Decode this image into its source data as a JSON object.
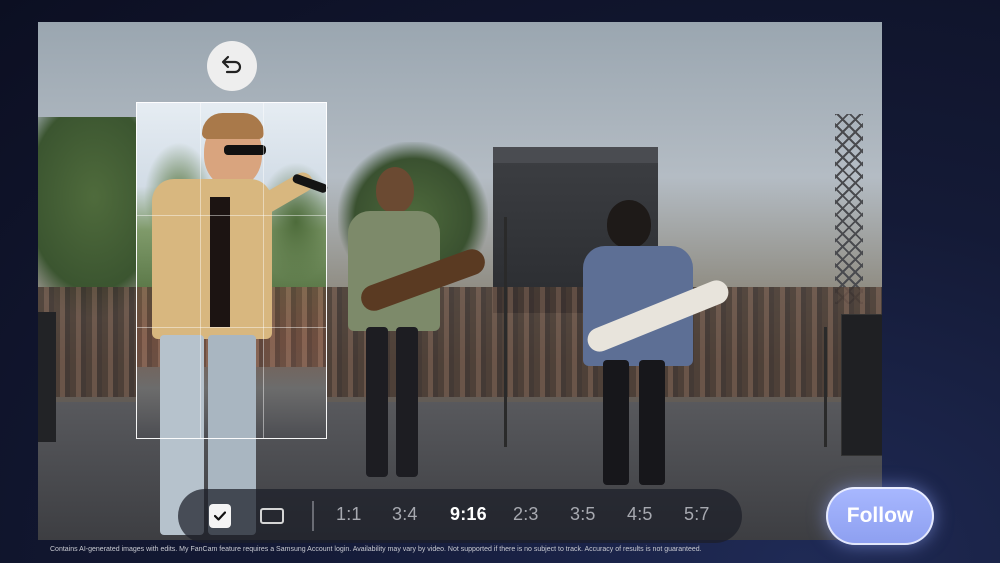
{
  "undo": {
    "icon": "undo-arrow-icon"
  },
  "ratio_bar": {
    "check_icon": "checkbox-checked-icon",
    "frame_icon": "rectangle-frame-icon",
    "ratios": [
      {
        "label": "1:1",
        "active": false
      },
      {
        "label": "3:4",
        "active": false
      },
      {
        "label": "9:16",
        "active": true
      },
      {
        "label": "2:3",
        "active": false
      },
      {
        "label": "3:5",
        "active": false
      },
      {
        "label": "4:5",
        "active": false
      },
      {
        "label": "5:7",
        "active": false
      }
    ]
  },
  "follow_button": {
    "label": "Follow",
    "color": "#9aaaf8"
  },
  "disclaimer": "Contains AI-generated images with edits. My FanCam feature requires a Samsung Account login. Availability may vary by video. Not supported if there is no subject to track. Accuracy of results is not guaranteed."
}
